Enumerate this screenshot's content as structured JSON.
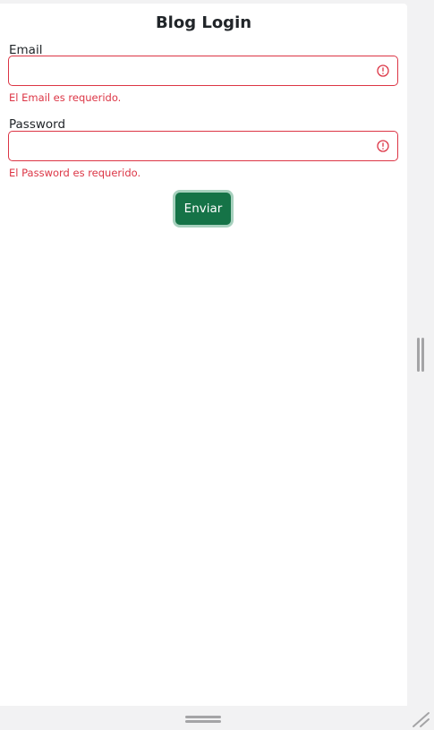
{
  "form": {
    "title": "Blog Login",
    "email": {
      "label": "Email",
      "value": "",
      "error": "El Email es requerido."
    },
    "password": {
      "label": "Password",
      "value": "",
      "error": "El Password es requerido."
    },
    "submit_label": "Enviar"
  },
  "colors": {
    "error": "#dc3545",
    "submit_bg": "#157347",
    "chrome_bg": "#f2f2f3"
  },
  "icons": {
    "field_status": "exclamation-circle-icon",
    "vertical_resizer": "grip-vertical-icon",
    "horizontal_resizer": "grip-horizontal-icon",
    "corner_resizer": "resize-corner-icon"
  }
}
